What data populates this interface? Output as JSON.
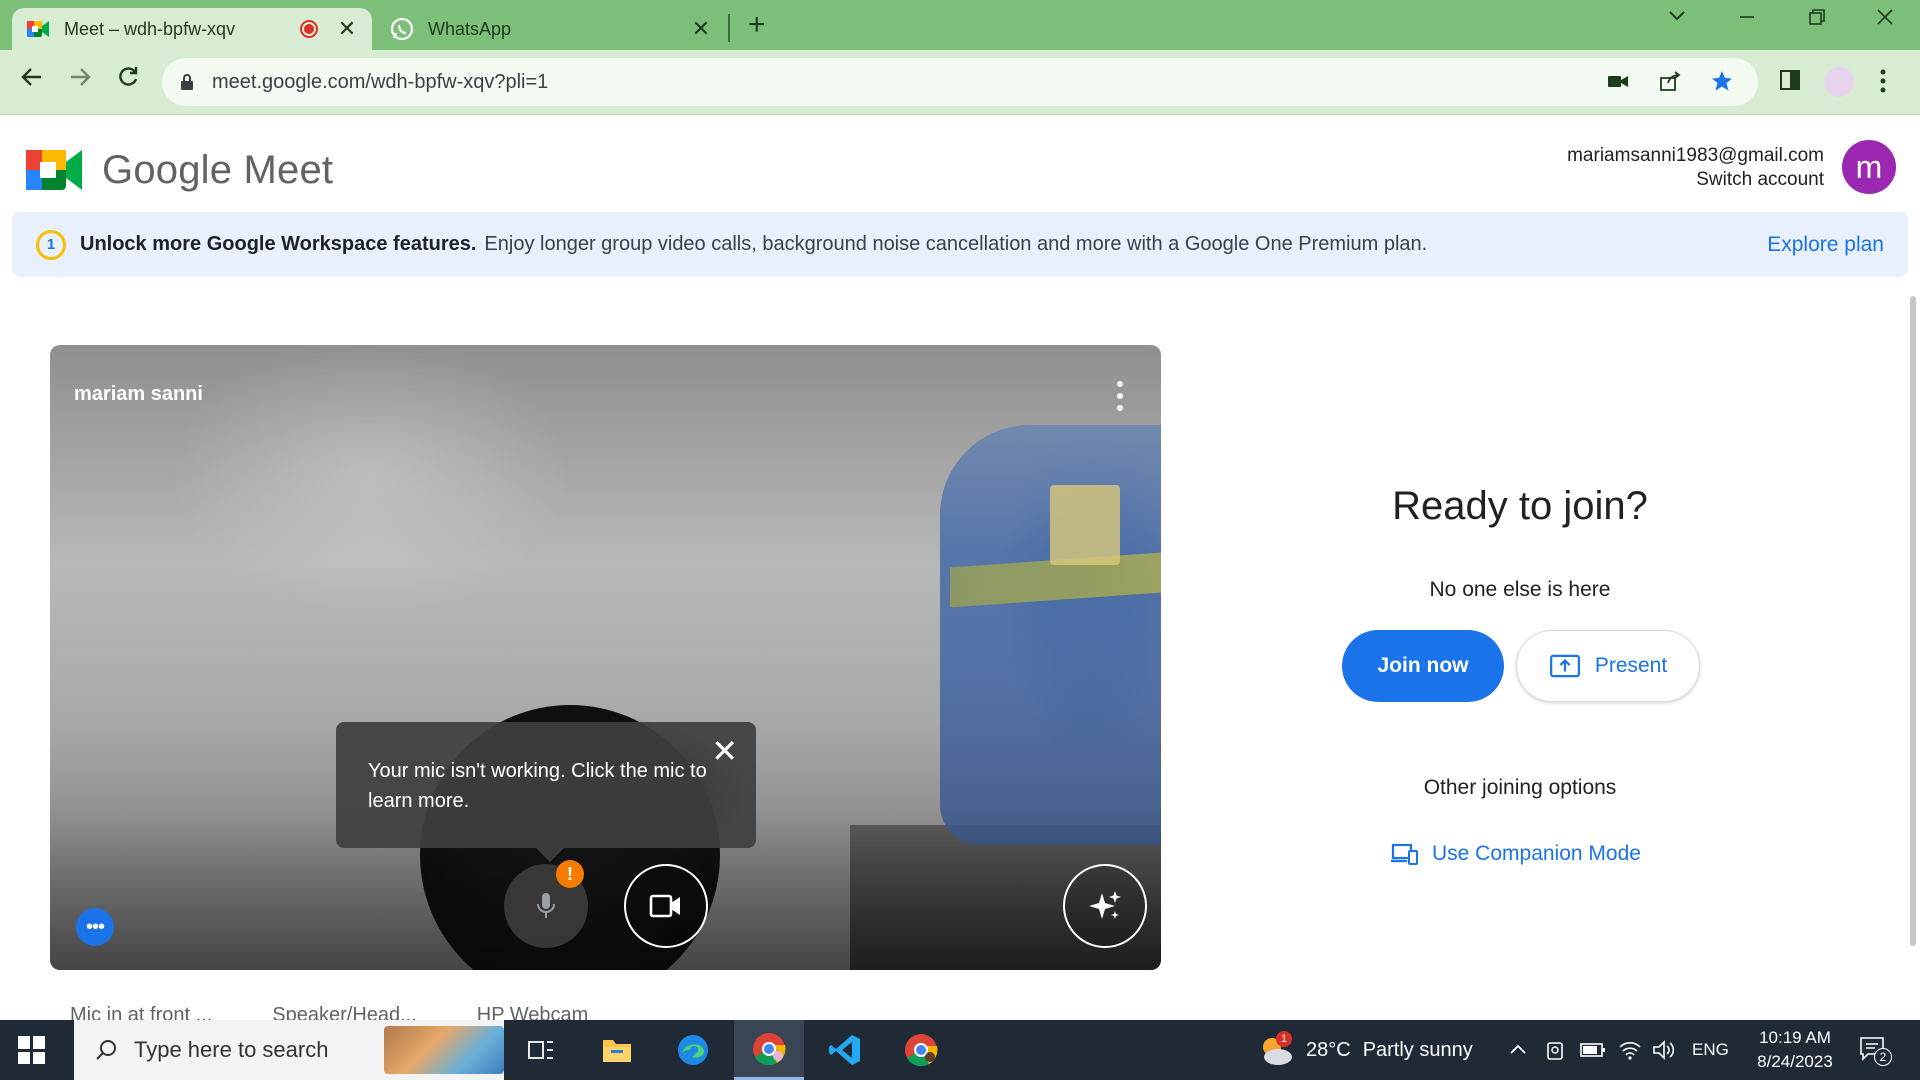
{
  "browser": {
    "tabs": [
      {
        "title": "Meet – wdh-bpfw-xqv",
        "active": true,
        "recording": true
      },
      {
        "title": "WhatsApp",
        "active": false
      }
    ],
    "url": "meet.google.com/wdh-bpfw-xqv?pli=1"
  },
  "header": {
    "logo_text": "Google Meet",
    "account_email": "mariamsanni1983@gmail.com",
    "switch_account": "Switch account",
    "avatar_letter": "m"
  },
  "banner": {
    "bold": "Unlock more Google Workspace features.",
    "text": "Enjoy longer group video calls, background noise cancellation and more with a Google One Premium plan.",
    "link": "Explore plan"
  },
  "preview": {
    "user_name": "mariam sanni",
    "mic_tooltip": "Your mic isn't working. Click the mic to learn more.",
    "mic_status": "warning"
  },
  "devices": {
    "mic": "Mic in at front ...",
    "speaker": "Speaker/Head...",
    "camera": "HP Webcam"
  },
  "join": {
    "title": "Ready to join?",
    "status": "No one else is here",
    "join_label": "Join now",
    "present_label": "Present",
    "other_options": "Other joining options",
    "companion_label": "Use Companion Mode"
  },
  "taskbar": {
    "search_placeholder": "Type here to search",
    "weather_temp": "28°C",
    "weather_desc": "Partly sunny",
    "weather_badge": "1",
    "language": "ENG",
    "time": "10:19 AM",
    "date": "8/24/2023",
    "notification_count": "2"
  },
  "colors": {
    "chrome_frame": "#7cbf79",
    "chrome_toolbar": "#d8ecd4",
    "meet_blue": "#1a73e8",
    "avatar": "#9c27b0",
    "warning": "#f57c00"
  }
}
